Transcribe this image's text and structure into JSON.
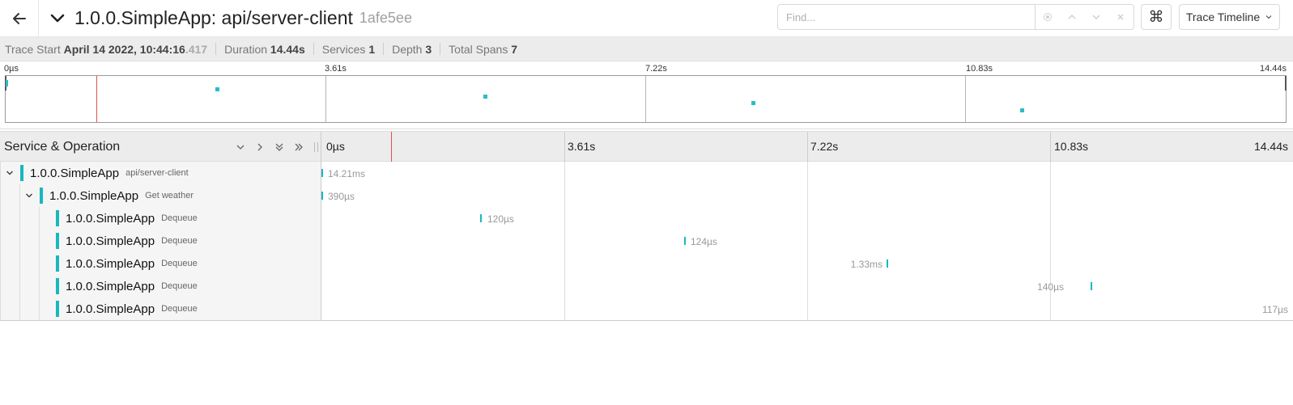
{
  "header": {
    "title": "1.0.0.SimpleApp: api/server-client",
    "trace_id": "1afe5ee",
    "find_placeholder": "Find...",
    "keyboard_glyph": "⌘",
    "view_label": "Trace Timeline"
  },
  "meta": {
    "trace_start_label": "Trace Start",
    "trace_start_value": "April 14 2022, 10:44:16",
    "trace_start_ms": ".417",
    "duration_label": "Duration",
    "duration_value": "14.44s",
    "services_label": "Services",
    "services_value": "1",
    "depth_label": "Depth",
    "depth_value": "3",
    "total_spans_label": "Total Spans",
    "total_spans_value": "7"
  },
  "minimap": {
    "ticks": [
      "0µs",
      "3.61s",
      "7.22s",
      "10.83s",
      "14.44s"
    ]
  },
  "timeline": {
    "column_header": "Service & Operation",
    "ticks": [
      "0µs",
      "3.61s",
      "7.22s",
      "10.83s",
      "14.44s"
    ]
  },
  "spans": [
    {
      "service": "1.0.0.SimpleApp",
      "operation": "api/server-client",
      "duration": "14.21ms"
    },
    {
      "service": "1.0.0.SimpleApp",
      "operation": "Get weather",
      "duration": "390µs"
    },
    {
      "service": "1.0.0.SimpleApp",
      "operation": "Dequeue",
      "duration": "120µs"
    },
    {
      "service": "1.0.0.SimpleApp",
      "operation": "Dequeue",
      "duration": "124µs"
    },
    {
      "service": "1.0.0.SimpleApp",
      "operation": "Dequeue",
      "duration": "1.33ms"
    },
    {
      "service": "1.0.0.SimpleApp",
      "operation": "Dequeue",
      "duration": "140µs"
    },
    {
      "service": "1.0.0.SimpleApp",
      "operation": "Dequeue",
      "duration": "117µs"
    }
  ],
  "colors": {
    "span": "#17b8be",
    "cursor": "#e0504d"
  }
}
